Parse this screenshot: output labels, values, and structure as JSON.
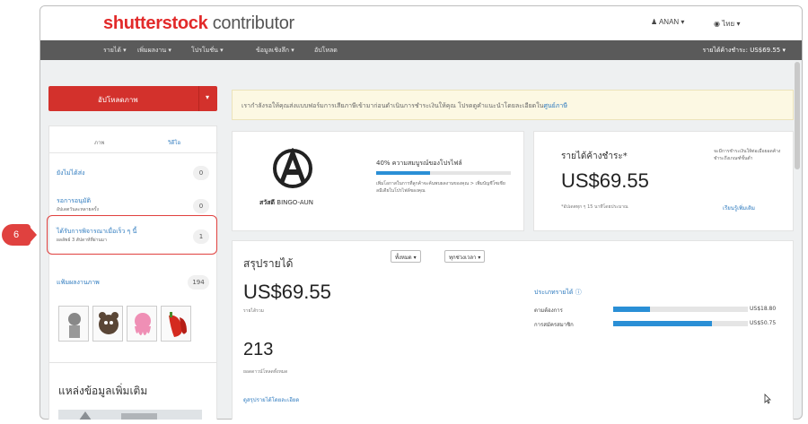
{
  "header": {
    "logo_brand": "shutterstock",
    "logo_sub": "contributor",
    "user_menu": "ANAN",
    "language_menu": "ไทย"
  },
  "nav": {
    "items": [
      "รายได้",
      "เพิ่มผลงาน",
      "โปรโมชั่น",
      "ข้อมูลเชิงลึก",
      "อัปโหลด"
    ],
    "balance": "รายได้ค้างชำระ: US$69.55"
  },
  "sidebar": {
    "upload_label": "อัปโหลดภาพ",
    "tab_images": "ภาพ",
    "tab_video": "วิดีโอ",
    "rows": [
      {
        "label": "ยังไม่ได้ส่ง",
        "sub": "",
        "count": "0"
      },
      {
        "label": "รอการอนุมัติ",
        "sub": "อัปเดตวันละหลายครั้ง",
        "count": "0"
      },
      {
        "label": "ได้รับการพิจารณาเมื่อเร็ว ๆ นี้",
        "sub": "ผลลัพธ์ 3 สัปดาห์ที่ผ่านมา",
        "count": "1"
      },
      {
        "label": "แฟ้มผลงานภาพ",
        "sub": "",
        "count": "194"
      }
    ],
    "callout_number": "6",
    "resources_title": "แหล่งข้อมูลเพิ่มเติม"
  },
  "banner": {
    "text": "เรากำลังรอให้คุณส่งแบบฟอร์มการเสียภาษีเข้ามาก่อนดำเนินการชำระเงินให้คุณ โปรดดูคำแนะนำโดยละเอียดใน",
    "link": "ศูนย์ภาษี"
  },
  "profile": {
    "logo_letter": "A",
    "name_prefix": "สวัสดี",
    "name": "BINGO-AUN",
    "completeness": "40% ความสมบูรณ์ของโปรไฟล์",
    "completeness_value": 0.4,
    "tip": "เพิ่มโอกาสในการที่ลูกค้าจะค้นพบผลงานของคุณ > เพิ่มบัญชีโซเชียลมีเดียในโปรไฟล์ของคุณ"
  },
  "earnings": {
    "title": "รายได้ค้างชำระ*",
    "amount": "US$69.55",
    "note": "*อัปเดตทุก ๆ 15 นาทีโดยประมาณ",
    "side_text": "จะมีการชำระเงินให้ต่อเมื่อยอดค้างชำระถึงเกณฑ์ขั้นต่ำ",
    "learn_more": "เรียนรู้เพิ่มเติม"
  },
  "summary": {
    "title": "สรุปรายได้",
    "filter_all": "ทั้งหมด",
    "filter_time": "ทุกช่วงเวลา",
    "total_amount": "US$69.55",
    "total_label": "รายได้รวม",
    "downloads": "213",
    "downloads_label": "ยอดดาวน์โหลดทั้งหมด",
    "details_link": "ดูสรุปรายได้โดยละเอียด",
    "types_title": "ประเภทรายได้",
    "types": [
      {
        "label": "ตามต้องการ",
        "amount": "US$18.80",
        "fraction": 0.27
      },
      {
        "label": "การสมัครสมาชิก",
        "amount": "US$50.75",
        "fraction": 0.73
      }
    ]
  }
}
